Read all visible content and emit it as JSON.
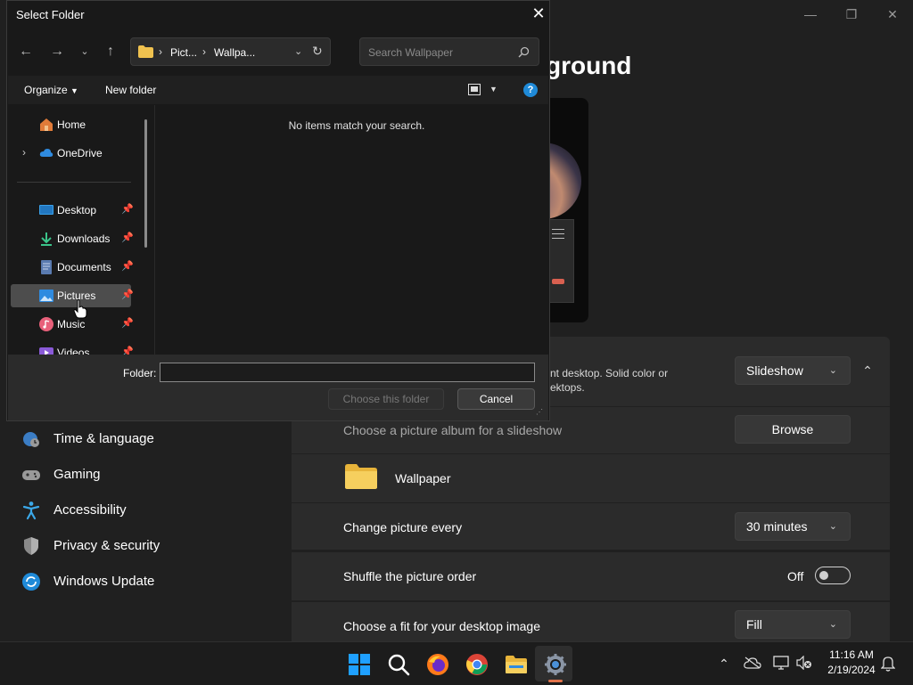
{
  "settings": {
    "heading": "ground",
    "window_controls": {
      "minimize": "—",
      "maximize": "❐",
      "close": "✕"
    },
    "background_row": {
      "desc_line1": "nt desktop. Solid color or",
      "desc_line2": "ektops.",
      "dropdown_value": "Slideshow"
    },
    "album_row": {
      "label": "Choose a picture album for a slideshow",
      "button": "Browse"
    },
    "folder_row": {
      "name": "Wallpaper"
    },
    "change_row": {
      "label": "Change picture every",
      "value": "30 minutes"
    },
    "shuffle_row": {
      "label": "Shuffle the picture order",
      "state": "Off"
    },
    "fit_row": {
      "label": "Choose a fit for your desktop image",
      "value": "Fill"
    },
    "nav": [
      {
        "label": "Time & language",
        "icon": "globe-clock-icon"
      },
      {
        "label": "Gaming",
        "icon": "gamepad-icon"
      },
      {
        "label": "Accessibility",
        "icon": "accessibility-icon"
      },
      {
        "label": "Privacy & security",
        "icon": "shield-icon"
      },
      {
        "label": "Windows Update",
        "icon": "update-icon"
      }
    ]
  },
  "dialog": {
    "title": "Select Folder",
    "breadcrumb": [
      "Pict...",
      "Wallpa..."
    ],
    "search_placeholder": "Search Wallpaper",
    "toolbar": {
      "organize": "Organize",
      "new_folder": "New folder"
    },
    "nav_items": [
      {
        "label": "Home",
        "icon": "home-icon",
        "pinned": false
      },
      {
        "label": "OneDrive",
        "icon": "cloud-icon",
        "pinned": false
      },
      {
        "label": "Desktop",
        "icon": "desktop-icon",
        "pinned": true
      },
      {
        "label": "Downloads",
        "icon": "download-icon",
        "pinned": true
      },
      {
        "label": "Documents",
        "icon": "document-icon",
        "pinned": true
      },
      {
        "label": "Pictures",
        "icon": "pictures-icon",
        "pinned": true,
        "selected": true
      },
      {
        "label": "Music",
        "icon": "music-icon",
        "pinned": true
      },
      {
        "label": "Videos",
        "icon": "video-icon",
        "pinned": true
      }
    ],
    "empty_message": "No items match your search.",
    "folder_label": "Folder:",
    "folder_value": "",
    "choose_button": "Choose this folder",
    "cancel_button": "Cancel"
  },
  "taskbar": {
    "time": "11:16 AM",
    "date": "2/19/2024",
    "apps": [
      "start-icon",
      "search-icon",
      "firefox-icon",
      "chrome-icon",
      "file-explorer-icon",
      "settings-icon"
    ]
  },
  "colors": {
    "accent": "#0078d4",
    "folder": "#f0c24f",
    "bg": "#202020",
    "card": "#2b2b2b"
  }
}
